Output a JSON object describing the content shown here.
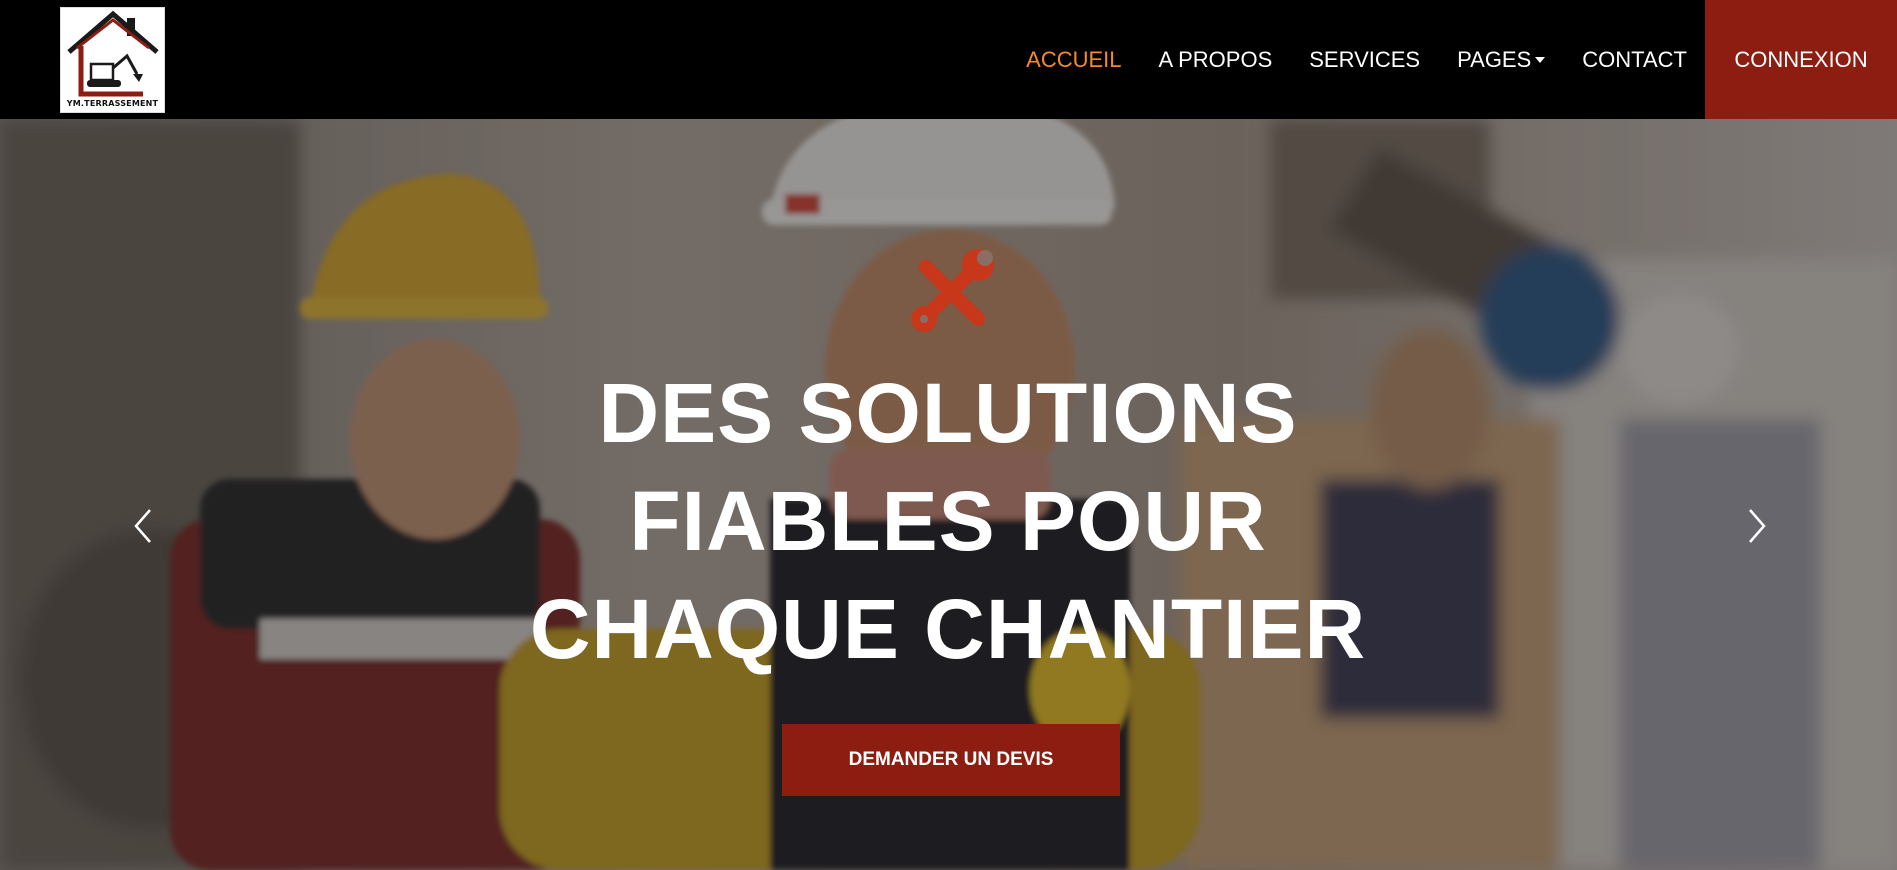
{
  "brand": {
    "logo_text": "YM.TERRASSEMENT",
    "logo_icon": "house-excavator-icon"
  },
  "nav": {
    "items": [
      {
        "label": "ACCUEIL",
        "active": true
      },
      {
        "label": "A PROPOS",
        "active": false
      },
      {
        "label": "SERVICES",
        "active": false
      },
      {
        "label": "PAGES",
        "active": false,
        "dropdown": true
      },
      {
        "label": "CONTACT",
        "active": false
      }
    ],
    "login_label": "CONNEXION"
  },
  "hero": {
    "icon": "tools-icon",
    "title_lines": [
      "DES SOLUTIONS",
      "FIABLES POUR",
      "CHAQUE CHANTIER"
    ],
    "cta_label": "DEMANDER UN DEVIS",
    "prev_icon": "chevron-left-icon",
    "next_icon": "chevron-right-icon"
  },
  "colors": {
    "navbar_bg": "#000000",
    "active_link": "#f28a30",
    "accent": "#8c1d10",
    "icon_accent": "#c8371a"
  }
}
